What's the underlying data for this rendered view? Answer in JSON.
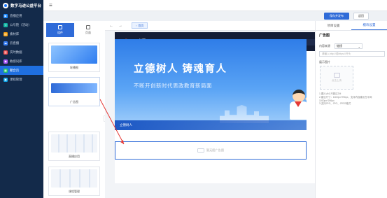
{
  "brand": {
    "title": "数字马迹公益平台"
  },
  "sidebar": {
    "items": [
      {
        "label": "直播应用",
        "icon": "live-icon",
        "color": "#1f8bff"
      },
      {
        "label": "公号链（活动）",
        "icon": "link-icon",
        "color": "#14b8a6"
      },
      {
        "label": "素材库",
        "icon": "folder-icon",
        "color": "#f59e0b"
      },
      {
        "label": "云直播",
        "icon": "cloud-icon",
        "color": "#3b82f6"
      },
      {
        "label": "实时数据",
        "icon": "chart-icon",
        "color": "#ef4444"
      },
      {
        "label": "敏感词库",
        "icon": "shield-icon",
        "color": "#a855f7"
      },
      {
        "label": "聚合页",
        "icon": "page-icon",
        "color": "#22c55e",
        "active": true
      },
      {
        "label": "课程管理",
        "icon": "book-icon",
        "color": "#0ea5e9"
      }
    ]
  },
  "toolbar": {
    "publish_label": "保存并发布",
    "return_label": "返回"
  },
  "components_panel": {
    "tabs": [
      {
        "label": "组件"
      },
      {
        "label": "页面"
      }
    ],
    "items": [
      {
        "label": "轮播图"
      },
      {
        "label": "广告图"
      },
      {
        "label": "直播应用"
      },
      {
        "label": "课程管理"
      }
    ]
  },
  "canvas": {
    "page_tab": "首页",
    "preview": {
      "nav": [
        "首页",
        "课程"
      ],
      "search_placeholder": "请输入关键字",
      "hero_title": "立德树人 铸魂育人",
      "hero_subtitle": "不断开创新时代思政教育新局面",
      "hero_caption": "立德树人",
      "ad_placeholder": "暂无图广告图"
    }
  },
  "right_panel": {
    "tabs": [
      {
        "label": "项目设置"
      },
      {
        "label": "模块设置"
      }
    ],
    "title": "广告图",
    "source_label": "内容来源",
    "source_value": "链接",
    "link_placeholder": "请输入http://或https://开头",
    "image_label": "展示图片",
    "upload_label": "点击上传",
    "notes": [
      "1.图片大小不超过2M",
      "2.建议尺寸：1600px*296px，支持内容建议在中间1000px*296px",
      "3.支持JPG、JPG、JPEG格式"
    ]
  }
}
